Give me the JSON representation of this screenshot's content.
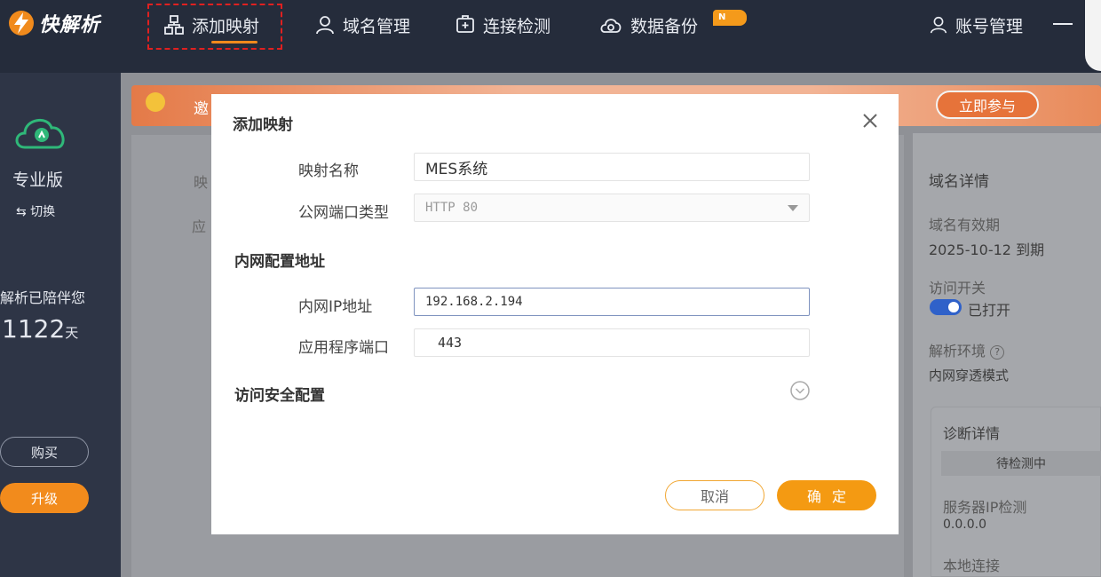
{
  "app": {
    "name": "快解析",
    "brand_color": "#f08a1c"
  },
  "nav": {
    "items": [
      {
        "label": "添加映射",
        "icon": "network-icon",
        "active": true
      },
      {
        "label": "域名管理",
        "icon": "user-icon"
      },
      {
        "label": "连接检测",
        "icon": "plus-box-icon"
      },
      {
        "label": "数据备份",
        "icon": "cloud-icon",
        "badge": "N"
      }
    ],
    "account_label": "账号管理"
  },
  "sidebar": {
    "edition": "专业版",
    "switch_label": "⇆ 切换",
    "companion_text": "解析已陪伴您",
    "days_value": "1122",
    "days_unit": "天",
    "buy_label": "购买",
    "upgrade_label": "升级"
  },
  "banner": {
    "join_label": "立即参与",
    "left_char": "邀"
  },
  "behind": {
    "label_1": "映",
    "label_2": "应"
  },
  "right_panel": {
    "title": "域名详情",
    "validity_label": "域名有效期",
    "validity_value": "2025-10-12 到期",
    "access_label": "访问开关",
    "access_value": "已打开",
    "env_label": "解析环境",
    "env_value": "内网穿透模式",
    "diag_title": "诊断详情",
    "diag_status": "待检测中",
    "server_ip_label": "服务器IP检测",
    "server_ip_value": "0.0.0.0",
    "local_conn_label": "本地连接"
  },
  "modal": {
    "title": "添加映射",
    "mapping_name_label": "映射名称",
    "mapping_name_value": "MES系统",
    "port_type_label": "公网端口类型",
    "port_type_value": "HTTP 80",
    "section_internal": "内网配置地址",
    "internal_ip_label": "内网IP地址",
    "internal_ip_value": "192.168.2.194",
    "app_port_label": "应用程序端口",
    "app_port_value": "443",
    "section_security": "访问安全配置",
    "cancel_label": "取消",
    "ok_label": "确定"
  }
}
